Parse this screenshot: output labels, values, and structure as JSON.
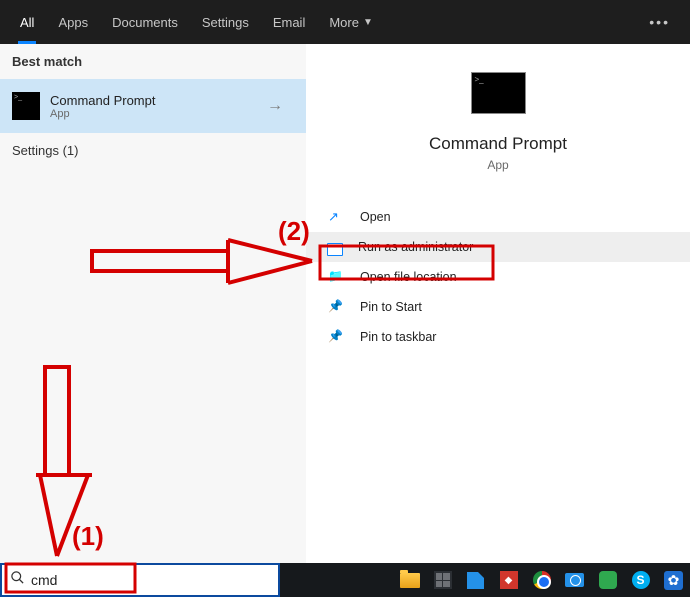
{
  "tabs": {
    "items": [
      {
        "label": "All",
        "active": true
      },
      {
        "label": "Apps",
        "active": false
      },
      {
        "label": "Documents",
        "active": false
      },
      {
        "label": "Settings",
        "active": false
      },
      {
        "label": "Email",
        "active": false
      },
      {
        "label": "More",
        "active": false
      }
    ]
  },
  "best_match_label": "Best match",
  "result": {
    "title": "Command Prompt",
    "subtitle": "App"
  },
  "settings_cat": "Settings (1)",
  "preview": {
    "title": "Command Prompt",
    "subtitle": "App"
  },
  "actions": {
    "open": "Open",
    "run_admin": "Run as administrator",
    "open_loc": "Open file location",
    "pin_start": "Pin to Start",
    "pin_taskbar": "Pin to taskbar"
  },
  "annotations": {
    "step1": "(1)",
    "step2": "(2)"
  },
  "search": {
    "value": "cmd"
  }
}
